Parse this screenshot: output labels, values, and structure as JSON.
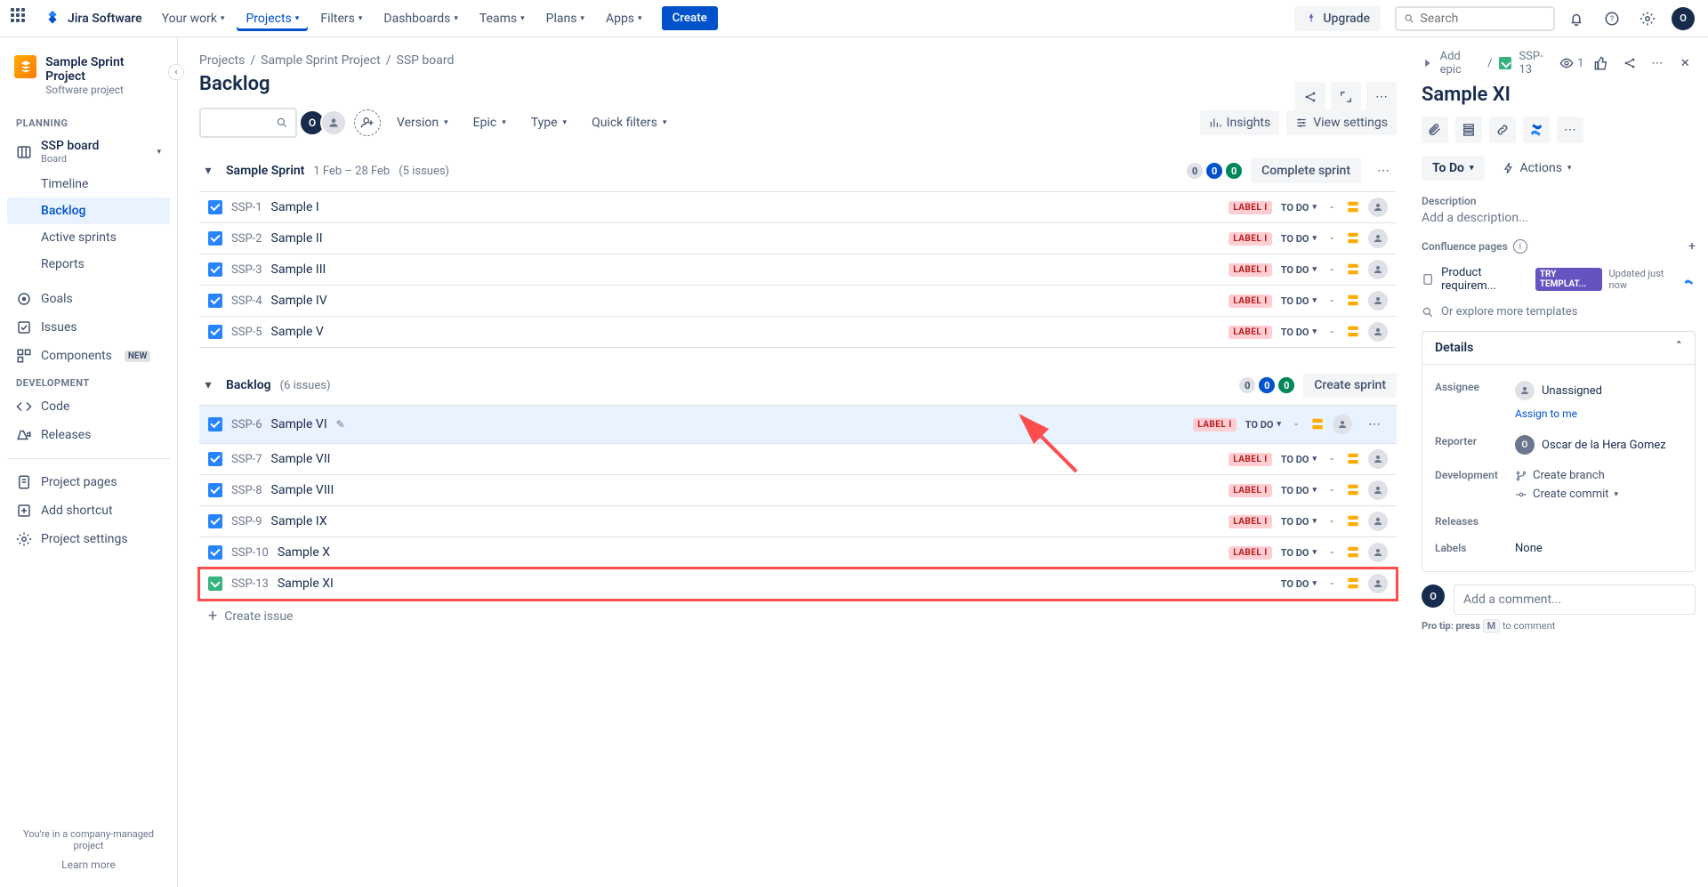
{
  "nav": {
    "logo_text": "Jira Software",
    "items": [
      "Your work",
      "Projects",
      "Filters",
      "Dashboards",
      "Teams",
      "Plans",
      "Apps"
    ],
    "create": "Create",
    "upgrade": "Upgrade",
    "search_placeholder": "Search"
  },
  "sidebar": {
    "project_name": "Sample Sprint Project",
    "project_sub": "Software project",
    "planning_label": "PLANNING",
    "board_name": "SSP board",
    "board_sub": "Board",
    "planning_items": [
      "Timeline",
      "Backlog",
      "Active sprints",
      "Reports"
    ],
    "other_items": [
      "Goals",
      "Issues",
      "Components"
    ],
    "new_badge": "NEW",
    "dev_label": "DEVELOPMENT",
    "dev_items": [
      "Code",
      "Releases"
    ],
    "bottom_items": [
      "Project pages",
      "Add shortcut",
      "Project settings"
    ],
    "footer": "You're in a company-managed project",
    "learn_more": "Learn more"
  },
  "crumbs": [
    "Projects",
    "Sample Sprint Project",
    "SSP board"
  ],
  "page_title": "Backlog",
  "filters": {
    "version": "Version",
    "epic": "Epic",
    "type": "Type",
    "quick": "Quick filters"
  },
  "tools": {
    "insights": "Insights",
    "view_settings": "View settings"
  },
  "sprint": {
    "name": "Sample Sprint",
    "dates": "1 Feb – 28 Feb",
    "count_text": "(5 issues)",
    "counts": [
      "0",
      "0",
      "0"
    ],
    "action": "Complete sprint",
    "issues": [
      {
        "key": "SSP-1",
        "summary": "Sample I",
        "label": "LABEL I",
        "status": "TO DO"
      },
      {
        "key": "SSP-2",
        "summary": "Sample II",
        "label": "LABEL I",
        "status": "TO DO"
      },
      {
        "key": "SSP-3",
        "summary": "Sample III",
        "label": "LABEL I",
        "status": "TO DO"
      },
      {
        "key": "SSP-4",
        "summary": "Sample IV",
        "label": "LABEL I",
        "status": "TO DO"
      },
      {
        "key": "SSP-5",
        "summary": "Sample V",
        "label": "LABEL I",
        "status": "TO DO"
      }
    ]
  },
  "backlog": {
    "name": "Backlog",
    "count_text": "(6 issues)",
    "counts": [
      "0",
      "0",
      "0"
    ],
    "action": "Create sprint",
    "issues": [
      {
        "key": "SSP-6",
        "summary": "Sample VI",
        "label": "LABEL I",
        "status": "TO DO",
        "type": "task",
        "selected": true
      },
      {
        "key": "SSP-7",
        "summary": "Sample VII",
        "label": "LABEL I",
        "status": "TO DO",
        "type": "task"
      },
      {
        "key": "SSP-8",
        "summary": "Sample VIII",
        "label": "LABEL I",
        "status": "TO DO",
        "type": "task"
      },
      {
        "key": "SSP-9",
        "summary": "Sample IX",
        "label": "LABEL I",
        "status": "TO DO",
        "type": "task"
      },
      {
        "key": "SSP-10",
        "summary": "Sample X",
        "label": "LABEL I",
        "status": "TO DO",
        "type": "task"
      },
      {
        "key": "SSP-13",
        "summary": "Sample XI",
        "label": "",
        "status": "TO DO",
        "type": "story",
        "highlighted": true
      }
    ],
    "create_issue": "Create issue"
  },
  "detail": {
    "add_epic": "Add epic",
    "key": "SSP-13",
    "watch_count": "1",
    "title": "Sample XI",
    "status": "To Do",
    "actions": "Actions",
    "description_label": "Description",
    "description_placeholder": "Add a description...",
    "confluence_label": "Confluence pages",
    "conf_page": "Product requirem...",
    "try_badge": "TRY TEMPLAT...",
    "updated": "Updated just now",
    "explore": "Or explore more templates",
    "details_label": "Details",
    "assignee_label": "Assignee",
    "assignee_value": "Unassigned",
    "assign_me": "Assign to me",
    "reporter_label": "Reporter",
    "reporter_value": "Oscar de la Hera Gomez",
    "development_label": "Development",
    "create_branch": "Create branch",
    "create_commit": "Create commit",
    "releases_label": "Releases",
    "labels_label": "Labels",
    "labels_value": "None",
    "comment_placeholder": "Add a comment...",
    "pro_tip_pre": "Pro tip: press ",
    "pro_tip_key": "M",
    "pro_tip_post": " to comment"
  }
}
